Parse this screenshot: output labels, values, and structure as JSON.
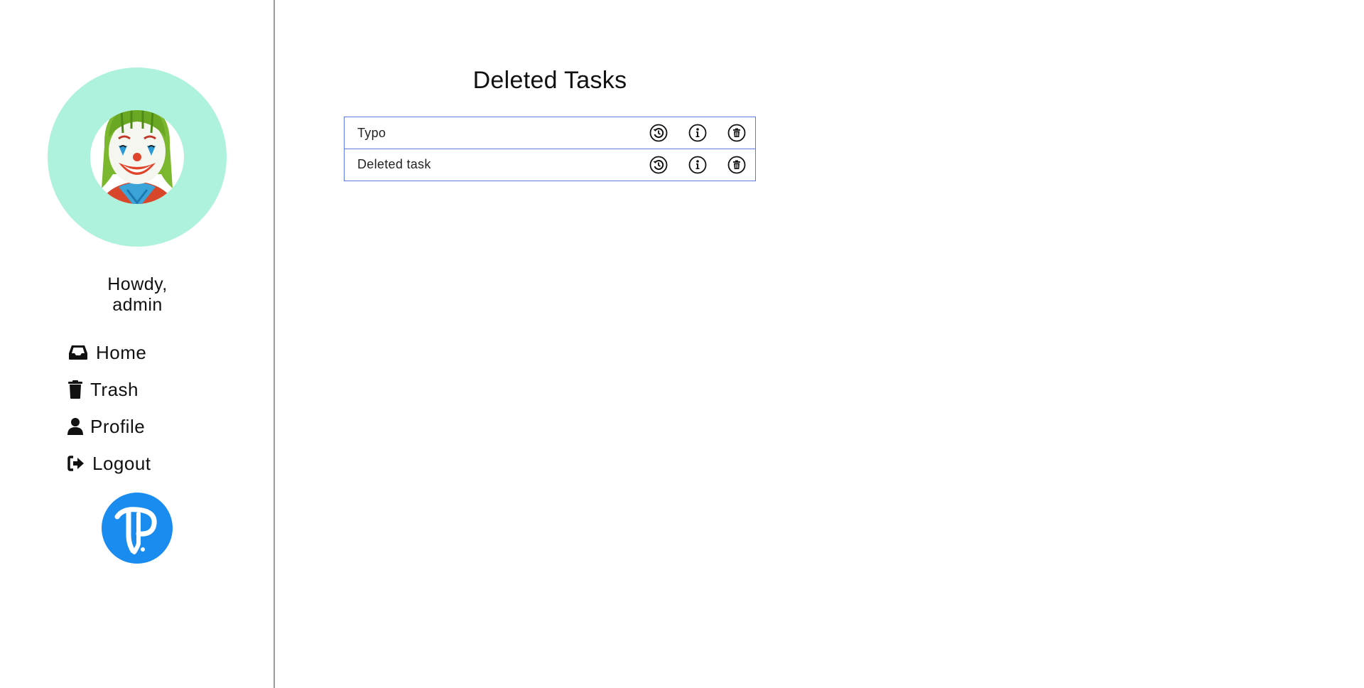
{
  "sidebar": {
    "avatar_icon": "joker-avatar",
    "greeting_line1": "Howdy,",
    "greeting_line2": "admin",
    "nav": [
      {
        "label": "Home",
        "icon": "inbox-icon"
      },
      {
        "label": "Trash",
        "icon": "trash-icon"
      },
      {
        "label": "Profile",
        "icon": "user-icon"
      },
      {
        "label": "Logout",
        "icon": "logout-icon"
      }
    ],
    "logo_icon": "tp-logo"
  },
  "main": {
    "title": "Deleted Tasks",
    "tasks": [
      {
        "name": "Typo",
        "actions": [
          "restore-icon",
          "info-icon",
          "delete-icon"
        ]
      },
      {
        "name": "Deleted task",
        "actions": [
          "restore-icon",
          "info-icon",
          "delete-icon"
        ]
      }
    ]
  },
  "colors": {
    "avatar_bg": "#aef2de",
    "row_border": "#5b78e6",
    "logo_blue": "#1a8cf0",
    "divider": "#9a9a9a"
  }
}
